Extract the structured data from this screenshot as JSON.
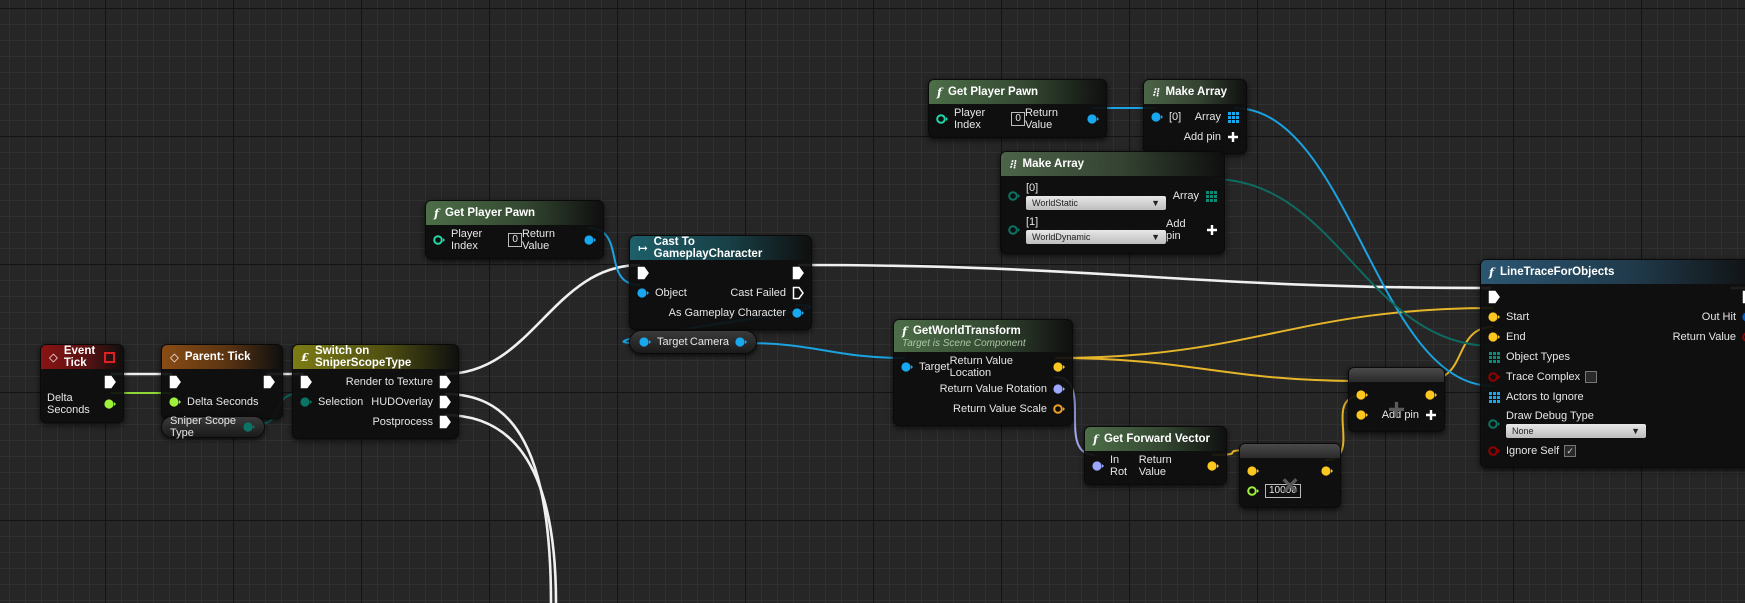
{
  "pin_colors": {
    "exec": "#ffffff",
    "object": "#17a8f0",
    "float": "#9ef03a",
    "int": "#20d8a8",
    "vector": "#fcc820",
    "rotator": "#9ca8ff",
    "transform": "#f0a020",
    "enum": "#0b7565",
    "bool": "#960000",
    "struct": "#0060d0",
    "array-obj": "#17a8f0",
    "array-enum": "#0b8a75"
  },
  "wire_colors": {
    "exec": "#f0f0f0",
    "object": "#1aa3e0",
    "float": "#8fd838",
    "vector": "#e6b52a",
    "rotator": "#a3a9ef",
    "enum": "#0e6b62"
  },
  "nodes": [
    {
      "kind": "node",
      "title": "Event Tick",
      "icon": "event-diamond-icon",
      "glyph": "◇",
      "color": "#8a1414",
      "delegate": true,
      "rows": [
        {
          "r": {
            "t": "exec"
          }
        },
        {
          "r": {
            "t": "float",
            "label": "Delta Seconds"
          }
        }
      ]
    },
    {
      "kind": "node",
      "title": "Parent: Tick",
      "icon": "event-diamond-icon",
      "glyph": "◇",
      "color": "#8a4c14",
      "rows": [
        {
          "l": {
            "t": "exec"
          },
          "r": {
            "t": "exec"
          }
        },
        {
          "l": {
            "t": "float",
            "label": "Delta Seconds"
          }
        }
      ]
    },
    {
      "kind": "node",
      "title": "Switch on SniperScopeType",
      "icon": "switch-icon",
      "glyph": "£",
      "color": "#7c7c14",
      "rows": [
        {
          "l": {
            "t": "exec"
          },
          "r": {
            "t": "exec",
            "label": "Render to Texture"
          }
        },
        {
          "l": {
            "t": "enum",
            "label": "Selection"
          },
          "r": {
            "t": "exec",
            "label": "HUDOverlay"
          }
        },
        {
          "r": {
            "t": "exec",
            "label": "Postprocess"
          }
        }
      ]
    },
    {
      "kind": "pill",
      "rows": [
        {
          "r": {
            "t": "enum",
            "label": "Sniper Scope Type"
          }
        }
      ]
    },
    {
      "kind": "node",
      "title": "Get Player Pawn",
      "icon": "function-icon",
      "glyph": "f",
      "color": "#4c6e48",
      "rows": [
        {
          "l": {
            "t": "int",
            "hollow": true,
            "label": "Player Index",
            "val": "0"
          },
          "r": {
            "t": "object",
            "label": "Return Value"
          }
        }
      ]
    },
    {
      "kind": "node",
      "title": "Cast To GameplayCharacter",
      "icon": "cast-arrow-icon",
      "glyph": "↦",
      "color": "#1d5f6a",
      "rows": [
        {
          "l": {
            "t": "exec"
          },
          "r": {
            "t": "exec"
          }
        },
        {
          "l": {
            "t": "object",
            "label": "Object"
          },
          "r": {
            "t": "exec",
            "hollow": true,
            "label": "Cast Failed"
          }
        },
        {
          "r": {
            "t": "object",
            "label": "As Gameplay Character"
          }
        }
      ]
    },
    {
      "kind": "pill",
      "rows": [
        {
          "l": {
            "t": "object",
            "label": "Target"
          },
          "r": {
            "t": "object",
            "label": "Camera"
          }
        }
      ]
    },
    {
      "kind": "node",
      "title": "GetWorldTransform",
      "subtitle": "Target is Scene Component",
      "icon": "function-icon",
      "glyph": "f",
      "color": "#4c6e48",
      "rows": [
        {
          "l": {
            "t": "object",
            "label": "Target"
          },
          "r": {
            "t": "vector",
            "label": "Return Value Location"
          }
        },
        {
          "r": {
            "t": "rotator",
            "label": "Return Value Rotation"
          }
        },
        {
          "r": {
            "t": "transform",
            "hollow": true,
            "label": "Return Value Scale"
          }
        }
      ]
    },
    {
      "kind": "node",
      "title": "Get Forward Vector",
      "icon": "function-icon",
      "glyph": "f",
      "color": "#4c6e48",
      "rows": [
        {
          "l": {
            "t": "rotator",
            "label": "In Rot"
          },
          "r": {
            "t": "vector",
            "label": "Return Value"
          }
        }
      ]
    },
    {
      "kind": "compact",
      "op": "×",
      "icon": "multiply-icon",
      "rows": [
        {
          "l": {
            "t": "vector"
          },
          "r": {
            "t": "vector"
          }
        },
        {
          "l": {
            "t": "float",
            "hollow": true,
            "val": "10000"
          }
        }
      ]
    },
    {
      "kind": "compact",
      "op": "+",
      "icon": "add-icon",
      "rows": [
        {
          "l": {
            "t": "vector"
          },
          "r": {
            "t": "vector"
          }
        },
        {
          "l": {
            "t": "vector"
          },
          "r": {
            "t": "addpin",
            "label": "Add pin"
          }
        }
      ]
    },
    {
      "kind": "node",
      "title": "Get Player Pawn",
      "icon": "function-icon",
      "glyph": "f",
      "color": "#4c6e48",
      "rows": [
        {
          "l": {
            "t": "int",
            "hollow": true,
            "label": "Player Index",
            "val": "0"
          },
          "r": {
            "t": "object",
            "label": "Return Value"
          }
        }
      ]
    },
    {
      "kind": "node",
      "title": "Make Array",
      "icon": "make-array-icon",
      "glyph": "⁝⁞",
      "color": "#4c6448",
      "rows": [
        {
          "l": {
            "t": "object",
            "label": "[0]"
          },
          "r": {
            "t": "array-obj",
            "label": "Array"
          }
        },
        {
          "r": {
            "t": "addpin",
            "label": "Add pin"
          }
        }
      ]
    },
    {
      "kind": "node",
      "title": "Make Array",
      "icon": "make-array-icon",
      "glyph": "⁝⁞",
      "color": "#4c6448",
      "rows": [
        {
          "l": {
            "t": "enum",
            "hollow": true,
            "label": "[0]",
            "dd": "WorldStatic"
          },
          "r": {
            "t": "array-enum",
            "label": "Array"
          }
        },
        {
          "l": {
            "t": "enum",
            "hollow": true,
            "label": "[1]",
            "dd": "WorldDynamic"
          },
          "r": {
            "t": "addpin",
            "label": "Add pin"
          }
        }
      ]
    },
    {
      "kind": "node",
      "title": "LineTraceForObjects",
      "icon": "function-icon",
      "glyph": "f",
      "color": "#2b5672",
      "rows": [
        {
          "l": {
            "t": "exec"
          },
          "r": {
            "t": "exec"
          }
        },
        {
          "l": {
            "t": "vector",
            "label": "Start"
          },
          "r": {
            "t": "struct",
            "label": "Out Hit"
          }
        },
        {
          "l": {
            "t": "vector",
            "label": "End"
          },
          "r": {
            "t": "bool",
            "hollow": true,
            "label": "Return Value"
          }
        },
        {
          "l": {
            "t": "array-enum",
            "label": "Object Types"
          }
        },
        {
          "l": {
            "t": "bool",
            "hollow": true,
            "label": "Trace Complex",
            "check": false
          }
        },
        {
          "l": {
            "t": "array-obj",
            "label": "Actors to Ignore"
          }
        },
        {
          "l": {
            "t": "enum",
            "hollow": true,
            "label": "Draw Debug Type",
            "dd": "None"
          }
        },
        {
          "l": {
            "t": "bool",
            "hollow": true,
            "label": "Ignore Self",
            "check": true
          }
        }
      ]
    }
  ]
}
